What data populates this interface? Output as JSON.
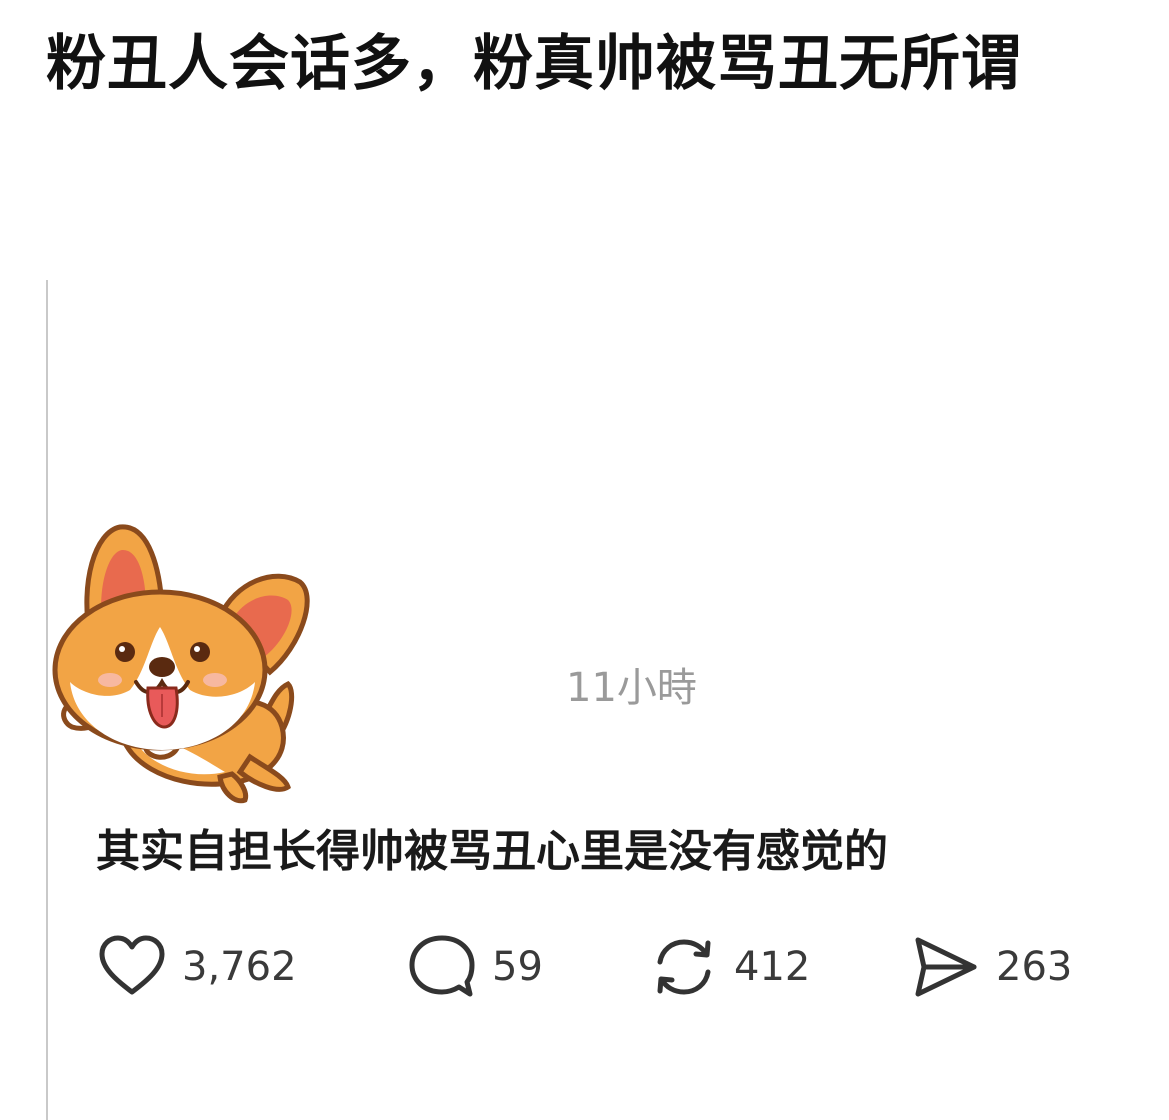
{
  "post": {
    "title": "粉丑人会话多，粉真帅被骂丑无所谓"
  },
  "reply": {
    "timestamp": "11小時",
    "text": "其实自担长得帅被骂丑心里是没有感觉的",
    "sticker_icon": "corgi-sticker-icon"
  },
  "actions": {
    "likes": "3,762",
    "comments": "59",
    "reposts": "412",
    "shares": "263"
  },
  "colors": {
    "text": "#111111",
    "muted": "#9a9a9a",
    "count": "#3a3a3a",
    "icon": "#333333",
    "corgi_orange": "#f2a445",
    "corgi_outline": "#8a4a1c"
  }
}
